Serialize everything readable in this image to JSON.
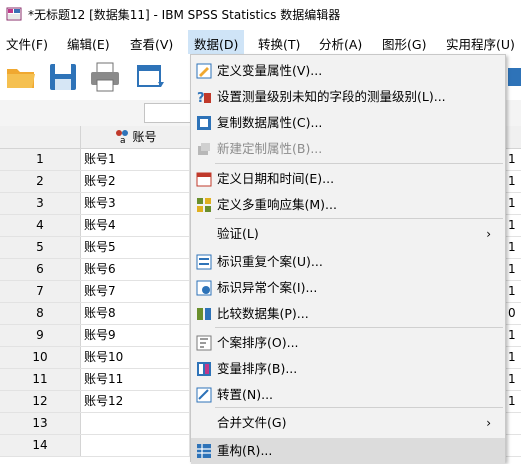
{
  "window": {
    "title": "*无标题12 [数据集11] - IBM SPSS Statistics 数据编辑器"
  },
  "menubar": {
    "items": [
      "文件(F)",
      "编辑(E)",
      "查看(V)",
      "数据(D)",
      "转换(T)",
      "分析(A)",
      "图形(G)",
      "实用程序(U)"
    ]
  },
  "grid": {
    "column_header": "账号",
    "rows": [
      {
        "num": "1",
        "value": "账号1",
        "right": "1"
      },
      {
        "num": "2",
        "value": "账号2",
        "right": "1"
      },
      {
        "num": "3",
        "value": "账号3",
        "right": "1"
      },
      {
        "num": "4",
        "value": "账号4",
        "right": "1"
      },
      {
        "num": "5",
        "value": "账号5",
        "right": "1"
      },
      {
        "num": "6",
        "value": "账号6",
        "right": "1"
      },
      {
        "num": "7",
        "value": "账号7",
        "right": "1"
      },
      {
        "num": "8",
        "value": "账号8",
        "right": "0"
      },
      {
        "num": "9",
        "value": "账号9",
        "right": "1"
      },
      {
        "num": "10",
        "value": "账号10",
        "right": "1"
      },
      {
        "num": "11",
        "value": "账号11",
        "right": "1"
      },
      {
        "num": "12",
        "value": "账号12",
        "right": "1"
      },
      {
        "num": "13",
        "value": "",
        "right": ""
      },
      {
        "num": "14",
        "value": "",
        "right": ""
      }
    ]
  },
  "data_menu": {
    "items": [
      {
        "label": "定义变量属性(V)...",
        "icon": "define-variable-icon"
      },
      {
        "label": "设置测量级别未知的字段的测量级别(L)...",
        "icon": "measure-level-icon"
      },
      {
        "label": "复制数据属性(C)...",
        "icon": "copy-properties-icon"
      },
      {
        "label": "新建定制属性(B)...",
        "icon": "custom-attribute-icon",
        "disabled": true
      },
      {
        "label": "定义日期和时间(E)...",
        "icon": "date-time-icon"
      },
      {
        "label": "定义多重响应集(M)...",
        "icon": "multiple-response-icon"
      },
      {
        "label": "验证(L)",
        "icon": "",
        "submenu": true
      },
      {
        "label": "标识重复个案(U)...",
        "icon": "duplicate-cases-icon"
      },
      {
        "label": "标识异常个案(I)...",
        "icon": "unusual-cases-icon"
      },
      {
        "label": "比较数据集(P)...",
        "icon": "compare-datasets-icon"
      },
      {
        "label": "个案排序(O)...",
        "icon": "sort-cases-icon"
      },
      {
        "label": "变量排序(B)...",
        "icon": "sort-variables-icon"
      },
      {
        "label": "转置(N)...",
        "icon": "transpose-icon"
      },
      {
        "label": "合并文件(G)",
        "icon": "",
        "submenu": true
      },
      {
        "label": "重构(R)...",
        "icon": "restructure-icon",
        "highlight": true
      }
    ],
    "submenu_arrow": "›"
  }
}
